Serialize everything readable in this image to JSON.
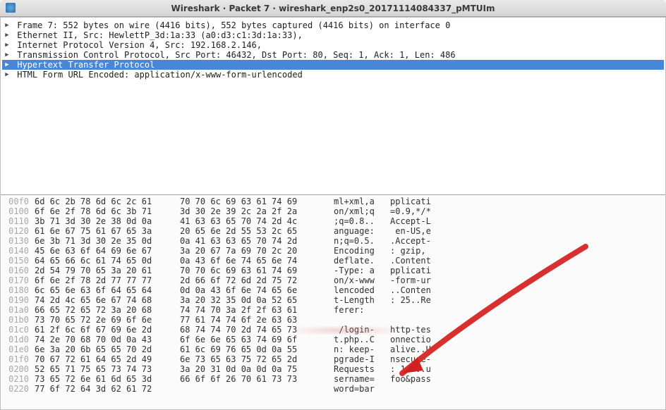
{
  "window_title": "Wireshark · Packet 7 · wireshark_enp2s0_20171114084337_pMTUIm",
  "tree": [
    {
      "label": "Frame 7: 552 bytes on wire (4416 bits), 552 bytes captured (4416 bits) on interface 0",
      "selected": false
    },
    {
      "label": "Ethernet II, Src: HewlettP_3d:1a:33 (a0:d3:c1:3d:1a:33),",
      "selected": false
    },
    {
      "label": "Internet Protocol Version 4, Src: 192.168.2.146,",
      "selected": false
    },
    {
      "label": "Transmission Control Protocol, Src Port: 46432, Dst Port: 80, Seq: 1, Ack: 1, Len: 486",
      "selected": false
    },
    {
      "label": "Hypertext Transfer Protocol",
      "selected": true
    },
    {
      "label": "HTML Form URL Encoded: application/x-www-form-urlencoded",
      "selected": false
    }
  ],
  "hex": [
    {
      "off": "00f0",
      "b1": "6d 6c 2b 78 6d 6c 2c 61",
      "b2": "70 70 6c 69 63 61 74 69",
      "a1": "ml+xml,a",
      "a2": "pplicati"
    },
    {
      "off": "0100",
      "b1": "6f 6e 2f 78 6d 6c 3b 71",
      "b2": "3d 30 2e 39 2c 2a 2f 2a",
      "a1": "on/xml;q",
      "a2": "=0.9,*/*"
    },
    {
      "off": "0110",
      "b1": "3b 71 3d 30 2e 38 0d 0a",
      "b2": "41 63 63 65 70 74 2d 4c",
      "a1": ";q=0.8..",
      "a2": "Accept-L"
    },
    {
      "off": "0120",
      "b1": "61 6e 67 75 61 67 65 3a",
      "b2": "20 65 6e 2d 55 53 2c 65",
      "a1": "anguage:",
      "a2": " en-US,e"
    },
    {
      "off": "0130",
      "b1": "6e 3b 71 3d 30 2e 35 0d",
      "b2": "0a 41 63 63 65 70 74 2d",
      "a1": "n;q=0.5.",
      "a2": ".Accept-"
    },
    {
      "off": "0140",
      "b1": "45 6e 63 6f 64 69 6e 67",
      "b2": "3a 20 67 7a 69 70 2c 20",
      "a1": "Encoding",
      "a2": ": gzip, "
    },
    {
      "off": "0150",
      "b1": "64 65 66 6c 61 74 65 0d",
      "b2": "0a 43 6f 6e 74 65 6e 74",
      "a1": "deflate.",
      "a2": ".Content"
    },
    {
      "off": "0160",
      "b1": "2d 54 79 70 65 3a 20 61",
      "b2": "70 70 6c 69 63 61 74 69",
      "a1": "-Type: a",
      "a2": "pplicati"
    },
    {
      "off": "0170",
      "b1": "6f 6e 2f 78 2d 77 77 77",
      "b2": "2d 66 6f 72 6d 2d 75 72",
      "a1": "on/x-www",
      "a2": "-form-ur"
    },
    {
      "off": "0180",
      "b1": "6c 65 6e 63 6f 64 65 64",
      "b2": "0d 0a 43 6f 6e 74 65 6e",
      "a1": "lencoded",
      "a2": "..Conten"
    },
    {
      "off": "0190",
      "b1": "74 2d 4c 65 6e 67 74 68",
      "b2": "3a 20 32 35 0d 0a 52 65",
      "a1": "t-Length",
      "a2": ": 25..Re"
    },
    {
      "off": "01a0",
      "b1": "66 65 72 65 72 3a 20 68",
      "b2": "74 74 70 3a 2f 2f 63 61",
      "a1": "ferer:  ",
      "a2": "        "
    },
    {
      "off": "01b0",
      "b1": "73 70 65 72 2e 69 6f 6e",
      "b2": "77 61 74 74 6f 2e 63 63",
      "a1": "        ",
      "a2": "        "
    },
    {
      "off": "01c0",
      "b1": "61 2f 6c 6f 67 69 6e 2d",
      "b2": "68 74 74 70 2d 74 65 73",
      "a1": " /login-",
      "a2": "http-tes"
    },
    {
      "off": "01d0",
      "b1": "74 2e 70 68 70 0d 0a 43",
      "b2": "6f 6e 6e 65 63 74 69 6f",
      "a1": "t.php..C",
      "a2": "onnectio"
    },
    {
      "off": "01e0",
      "b1": "6e 3a 20 6b 65 65 70 2d",
      "b2": "61 6c 69 76 65 0d 0a 55",
      "a1": "n: keep-",
      "a2": "alive..U"
    },
    {
      "off": "01f0",
      "b1": "70 67 72 61 64 65 2d 49",
      "b2": "6e 73 65 63 75 72 65 2d",
      "a1": "pgrade-I",
      "a2": "nsecure-"
    },
    {
      "off": "0200",
      "b1": "52 65 71 75 65 73 74 73",
      "b2": "3a 20 31 0d 0a 0d 0a 75",
      "a1": "Requests",
      "a2": ": 1....u"
    },
    {
      "off": "0210",
      "b1": "73 65 72 6e 61 6d 65 3d",
      "b2": "66 6f 6f 26 70 61 73 73",
      "a1": "sername=",
      "a2": "foo&pass"
    },
    {
      "off": "0220",
      "b1": "77 6f 72 64 3d 62 61 72",
      "b2": "",
      "a1": "word=bar",
      "a2": ""
    }
  ]
}
